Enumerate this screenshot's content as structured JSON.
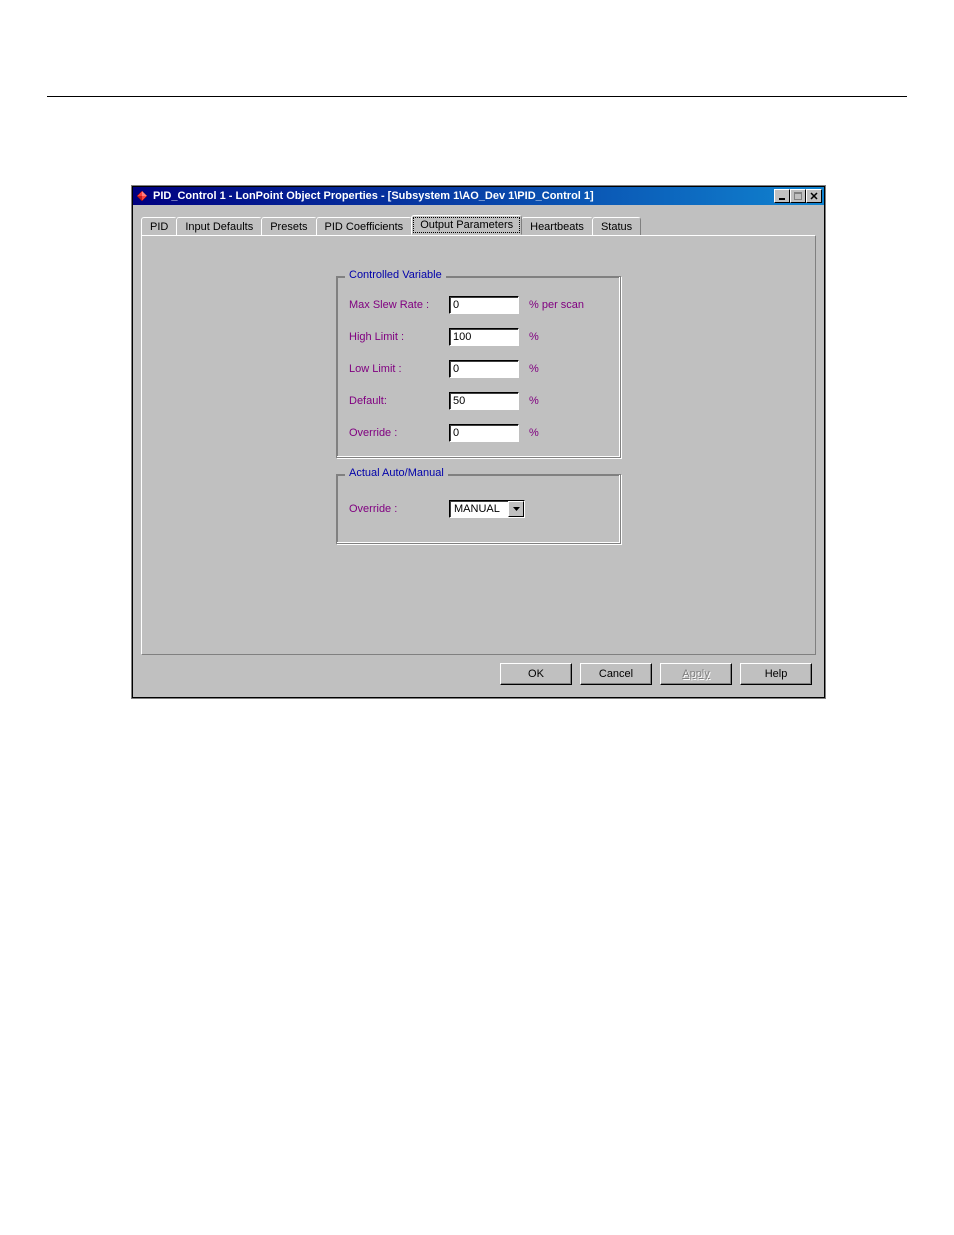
{
  "titlebar": {
    "text": "PID_Control 1 - LonPoint Object Properties - [Subsystem 1\\AO_Dev 1\\PID_Control 1]"
  },
  "tabs": {
    "pid": "PID",
    "input_defaults": "Input Defaults",
    "presets": "Presets",
    "pid_coefficients": "PID Coefficients",
    "output_parameters": "Output Parameters",
    "heartbeats": "Heartbeats",
    "status": "Status"
  },
  "group1": {
    "legend": "Controlled Variable",
    "rows": {
      "max_slew": {
        "label": "Max Slew Rate :",
        "value": "0",
        "unit": "% per scan"
      },
      "high_limit": {
        "label": "High Limit :",
        "value": "100",
        "unit": "%"
      },
      "low_limit": {
        "label": "Low Limit :",
        "value": "0",
        "unit": "%"
      },
      "default": {
        "label": "Default:",
        "value": "50",
        "unit": "%"
      },
      "override": {
        "label": "Override :",
        "value": "0",
        "unit": "%"
      }
    }
  },
  "group2": {
    "legend": "Actual Auto/Manual",
    "override_label": "Override :",
    "select_value": "MANUAL"
  },
  "buttons": {
    "ok": "OK",
    "cancel": "Cancel",
    "apply": "Apply",
    "help": "Help"
  }
}
